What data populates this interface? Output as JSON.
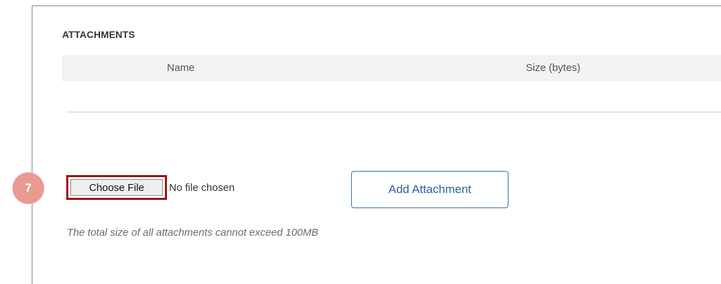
{
  "attachments": {
    "title": "ATTACHMENTS",
    "columns": [
      "Name",
      "Size (bytes)"
    ],
    "rows": []
  },
  "step_badge": "7",
  "file_input": {
    "button_label": "Choose File",
    "status": "No file chosen"
  },
  "add_button_label": "Add Attachment",
  "hint": "The total size of all attachments cannot exceed 100MB",
  "colors": {
    "badge": "#e99a92",
    "highlight_border": "#9e1212",
    "button_border": "#3a6ea5",
    "button_text": "#2f5f98",
    "header_bg": "#f2f2f2"
  }
}
